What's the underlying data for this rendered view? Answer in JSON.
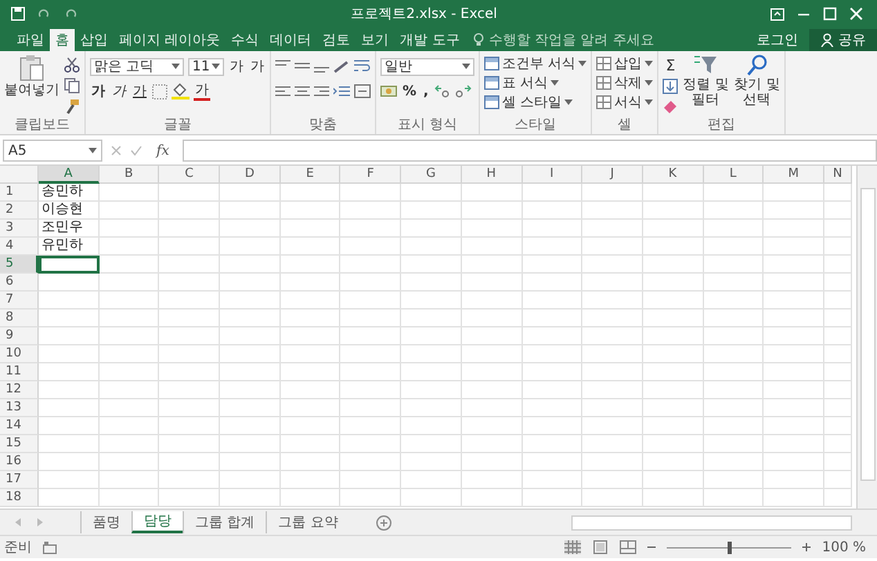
{
  "window": {
    "title": "프로젝트2.xlsx - Excel"
  },
  "ribbon_tabs": [
    {
      "label": "파일",
      "selected": false
    },
    {
      "label": "홈",
      "selected": true
    },
    {
      "label": "삽입",
      "selected": false
    },
    {
      "label": "페이지 레이아웃",
      "selected": false
    },
    {
      "label": "수식",
      "selected": false
    },
    {
      "label": "데이터",
      "selected": false
    },
    {
      "label": "검토",
      "selected": false
    },
    {
      "label": "보기",
      "selected": false
    },
    {
      "label": "개발 도구",
      "selected": false
    }
  ],
  "tell_me": {
    "placeholder": "수행할 작업을 알려 주세요"
  },
  "account": {
    "sign_in": "로그인",
    "share": "공유"
  },
  "clipboard": {
    "paste": "붙여넣기",
    "label": "클립보드"
  },
  "font": {
    "name": "맑은 고딕",
    "size": "11",
    "grow": "가",
    "shrink": "가",
    "bold": "가",
    "italic": "가",
    "underline": "가",
    "font_color": "가",
    "label": "글꼴"
  },
  "alignment": {
    "label": "맞춤"
  },
  "number": {
    "format": "일반",
    "percent": "%",
    "comma": ",",
    "label": "표시 형식"
  },
  "styles": {
    "items": [
      "조건부 서식",
      "표 서식",
      "셀 스타일"
    ],
    "label": "스타일"
  },
  "cells": {
    "items": [
      "삽입",
      "삭제",
      "서식"
    ],
    "label": "셀"
  },
  "editing": {
    "sum": "Σ",
    "sort": "정렬 및 필터",
    "find": "찾기 및 선택",
    "label": "편집"
  },
  "formula_bar": {
    "name_box": "A5",
    "fx": "fx"
  },
  "columns": [
    {
      "label": "A",
      "selected": true
    },
    {
      "label": "B",
      "selected": false
    },
    {
      "label": "C",
      "selected": false
    },
    {
      "label": "D",
      "selected": false
    },
    {
      "label": "E",
      "selected": false
    },
    {
      "label": "F",
      "selected": false
    },
    {
      "label": "G",
      "selected": false
    },
    {
      "label": "H",
      "selected": false
    },
    {
      "label": "I",
      "selected": false
    },
    {
      "label": "J",
      "selected": false
    },
    {
      "label": "K",
      "selected": false
    },
    {
      "label": "L",
      "selected": false
    },
    {
      "label": "M",
      "selected": false
    },
    {
      "label": "N",
      "selected": false
    }
  ],
  "rows": [
    {
      "header": "1",
      "selected": false,
      "cell": "송민하"
    },
    {
      "header": "2",
      "selected": false,
      "cell": "이승현"
    },
    {
      "header": "3",
      "selected": false,
      "cell": "조민우"
    },
    {
      "header": "4",
      "selected": false,
      "cell": "유민하"
    },
    {
      "header": "5",
      "selected": true
    },
    {
      "header": "6",
      "selected": false
    },
    {
      "header": "7",
      "selected": false
    },
    {
      "header": "8",
      "selected": false
    },
    {
      "header": "9",
      "selected": false
    },
    {
      "header": "10",
      "selected": false
    },
    {
      "header": "11",
      "selected": false
    },
    {
      "header": "12",
      "selected": false
    },
    {
      "header": "13",
      "selected": false
    },
    {
      "header": "14",
      "selected": false
    },
    {
      "header": "15",
      "selected": false
    },
    {
      "header": "16",
      "selected": false
    },
    {
      "header": "17",
      "selected": false
    },
    {
      "header": "18",
      "selected": false
    }
  ],
  "sheet_tabs": [
    {
      "label": "품명",
      "selected": false
    },
    {
      "label": "담당",
      "selected": true
    },
    {
      "label": "그룹 합계",
      "selected": false
    },
    {
      "label": "그룹 요약",
      "selected": false
    }
  ],
  "status": {
    "mode": "준비",
    "zoom": "100 %",
    "level": 0.5
  }
}
